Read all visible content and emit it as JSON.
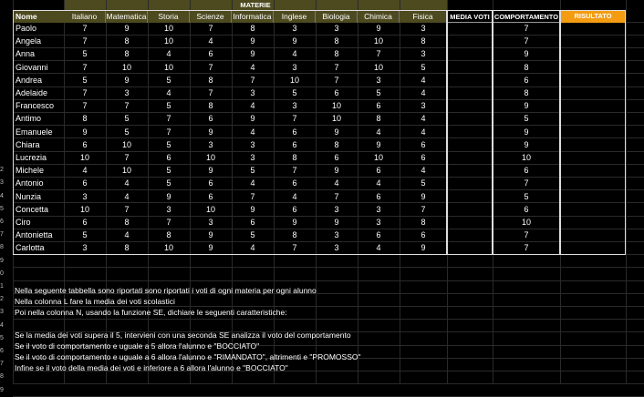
{
  "header": {
    "group_label": "MATERIE",
    "name_col": "Nome",
    "subjects": [
      "Italiano",
      "Matematica",
      "Storia",
      "Scienze",
      "Informatica",
      "Inglese",
      "Biologia",
      "Chimica",
      "Fisica"
    ],
    "media": "MEDIA VOTI",
    "comportamento": "COMPORTAMENTO",
    "risultato": "RISULTATO"
  },
  "row_numbers": [
    "",
    "",
    "",
    "",
    "",
    "",
    "",
    "",
    "",
    "",
    "",
    "2",
    "3",
    "4",
    "5",
    "6",
    "7",
    "8",
    "9",
    "0",
    "1",
    "2",
    "3",
    "4",
    "5",
    "6",
    "7",
    "8",
    "9",
    "0",
    "1"
  ],
  "students": [
    {
      "name": "Paolo",
      "grades": [
        7,
        9,
        10,
        7,
        8,
        3,
        3,
        9,
        3
      ],
      "comportamento": 7
    },
    {
      "name": "Angela",
      "grades": [
        7,
        8,
        10,
        4,
        9,
        9,
        8,
        10,
        8
      ],
      "comportamento": 7
    },
    {
      "name": "Anna",
      "grades": [
        5,
        8,
        4,
        6,
        9,
        4,
        8,
        7,
        3
      ],
      "comportamento": 9
    },
    {
      "name": "Giovanni",
      "grades": [
        7,
        10,
        10,
        7,
        4,
        3,
        7,
        10,
        5
      ],
      "comportamento": 8
    },
    {
      "name": "Andrea",
      "grades": [
        5,
        9,
        5,
        8,
        7,
        10,
        7,
        3,
        4
      ],
      "comportamento": 6
    },
    {
      "name": "Adelaide",
      "grades": [
        7,
        3,
        4,
        7,
        3,
        5,
        6,
        5,
        4
      ],
      "comportamento": 8
    },
    {
      "name": "Francesco",
      "grades": [
        7,
        7,
        5,
        8,
        4,
        3,
        10,
        6,
        3
      ],
      "comportamento": 9
    },
    {
      "name": "Antimo",
      "grades": [
        8,
        5,
        7,
        6,
        9,
        7,
        10,
        8,
        4
      ],
      "comportamento": 5
    },
    {
      "name": "Emanuele",
      "grades": [
        9,
        5,
        7,
        9,
        4,
        6,
        9,
        4,
        4
      ],
      "comportamento": 9
    },
    {
      "name": "Chiara",
      "grades": [
        6,
        10,
        5,
        3,
        3,
        6,
        8,
        9,
        6
      ],
      "comportamento": 9
    },
    {
      "name": "Lucrezia",
      "grades": [
        10,
        7,
        6,
        10,
        3,
        8,
        6,
        10,
        6
      ],
      "comportamento": 10
    },
    {
      "name": "Michele",
      "grades": [
        4,
        10,
        5,
        9,
        5,
        7,
        9,
        6,
        4
      ],
      "comportamento": 6
    },
    {
      "name": "Antonio",
      "grades": [
        6,
        4,
        5,
        6,
        4,
        6,
        4,
        4,
        5
      ],
      "comportamento": 7
    },
    {
      "name": "Nunzia",
      "grades": [
        3,
        4,
        9,
        6,
        7,
        4,
        7,
        6,
        9
      ],
      "comportamento": 5
    },
    {
      "name": "Concetta",
      "grades": [
        10,
        7,
        3,
        10,
        9,
        6,
        3,
        3,
        7
      ],
      "comportamento": 6
    },
    {
      "name": "Ciro",
      "grades": [
        6,
        8,
        7,
        3,
        6,
        9,
        9,
        3,
        8
      ],
      "comportamento": 10
    },
    {
      "name": "Antonietta",
      "grades": [
        5,
        4,
        8,
        9,
        5,
        8,
        3,
        6,
        6
      ],
      "comportamento": 7
    },
    {
      "name": "Carlotta",
      "grades": [
        3,
        8,
        10,
        9,
        4,
        7,
        3,
        4,
        9
      ],
      "comportamento": 7
    }
  ],
  "notes": [
    "Nella seguente tabbella sono riportati sono riportati i voti di ogni materia per ogni alunno",
    "Nella colonna L fare la media dei voti scolastici",
    "Poi nella colonna N, usando la funzione SE, dichiare le seguenti caratteristiche:",
    "",
    "Se la media dei voti supera il 5, intervieni con una seconda SE analizza il voto del comportamento",
    "Se il voto di comportamento e uguale a 5 allora l'alunno e \"BOCCIATO\"",
    "Se il voto di comportamento e uguale a 6 allora l'alunno e \"RIMANDATO\", altrimenti e \"PROMOSSO\"",
    "Infine se il voto della media dei voti e inferiore a 6 allora l'alunno e \"BOCCIATO\""
  ]
}
